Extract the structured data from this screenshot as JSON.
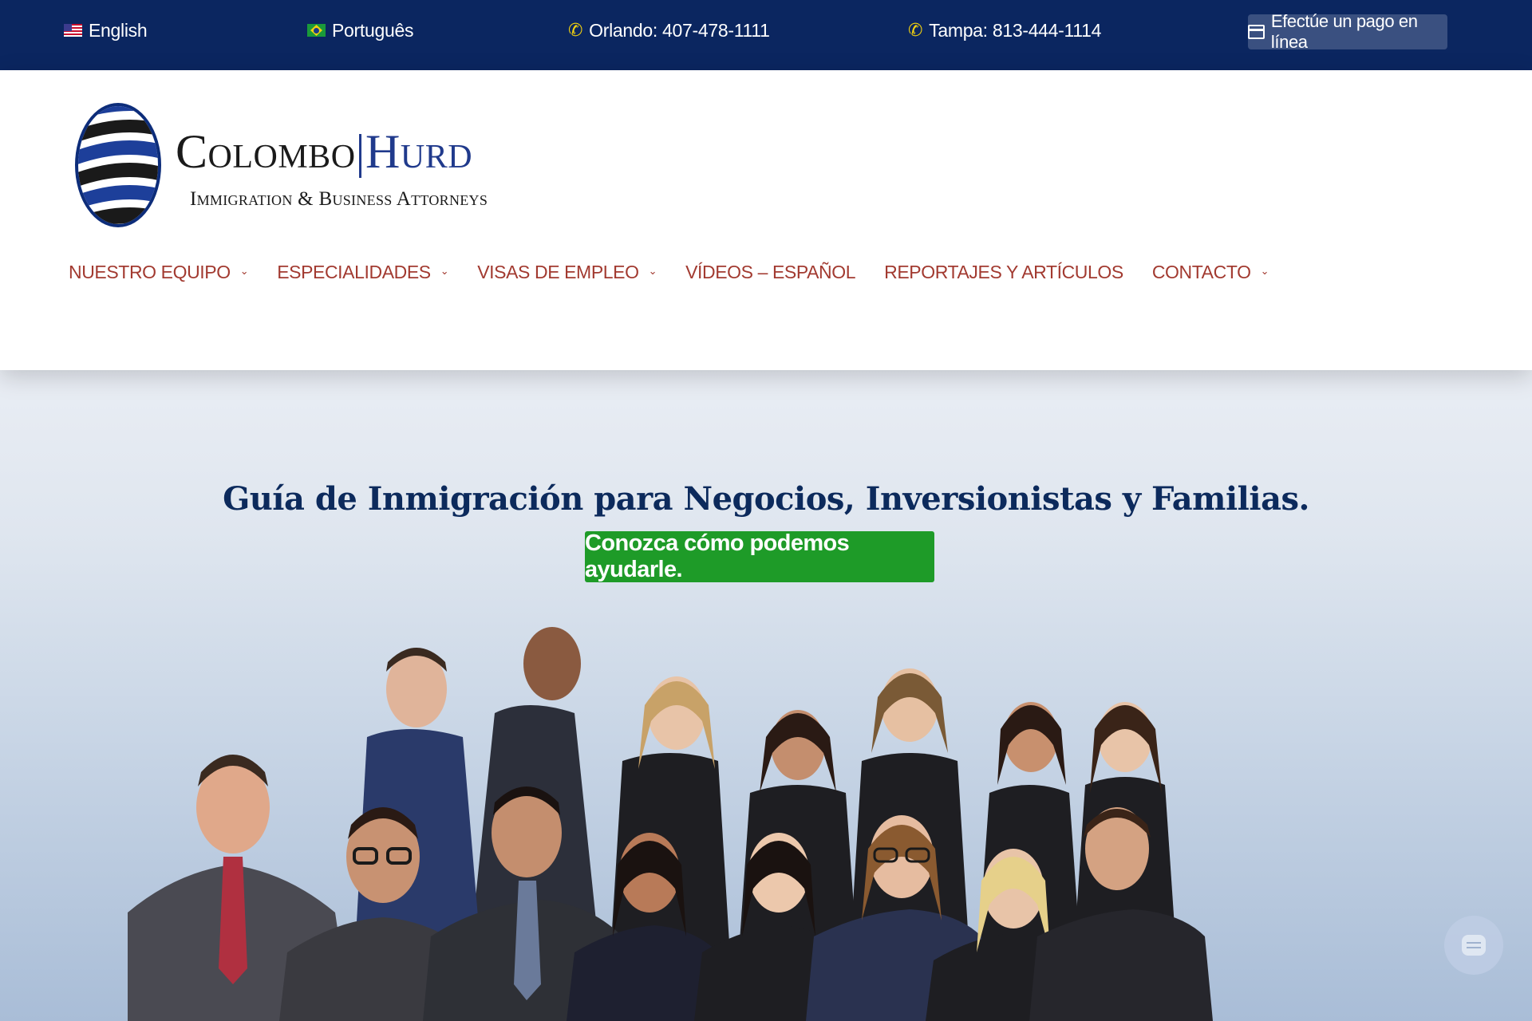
{
  "topbar": {
    "lang_english": "English",
    "lang_portuguese": "Português",
    "phone_orlando": "Orlando: 407-478-1111",
    "phone_tampa": "Tampa: 813-444-1114",
    "pay_button": "Efectúe un pago en línea"
  },
  "logo": {
    "name_part1": "Colombo",
    "separator": "|",
    "name_part2": "Hurd",
    "tagline": "Immigration & Business Attorneys"
  },
  "nav": {
    "items": [
      {
        "label": "NUESTRO EQUIPO",
        "has_dropdown": true
      },
      {
        "label": "ESPECIALIDADES",
        "has_dropdown": true
      },
      {
        "label": "VISAS DE EMPLEO",
        "has_dropdown": true
      },
      {
        "label": "VÍDEOS – ESPAÑOL",
        "has_dropdown": false
      },
      {
        "label": "REPORTAJES Y ARTÍCULOS",
        "has_dropdown": false
      },
      {
        "label": "CONTACTO",
        "has_dropdown": true
      }
    ]
  },
  "hero": {
    "title": "Guía de Inmigración para Negocios, Inversionistas y Familias.",
    "cta": "Conozca cómo podemos ayudarle."
  },
  "icons": {
    "flag_us": "us-flag-icon",
    "flag_br": "brazil-flag-icon",
    "phone": "phone-icon",
    "card": "credit-card-icon",
    "chevron": "chevron-down-icon",
    "chat": "chat-icon"
  },
  "colors": {
    "topbar_bg": "#0b2660",
    "nav_text": "#a23a30",
    "cta_bg": "#1e9b28",
    "title_text": "#0c2a5c"
  }
}
